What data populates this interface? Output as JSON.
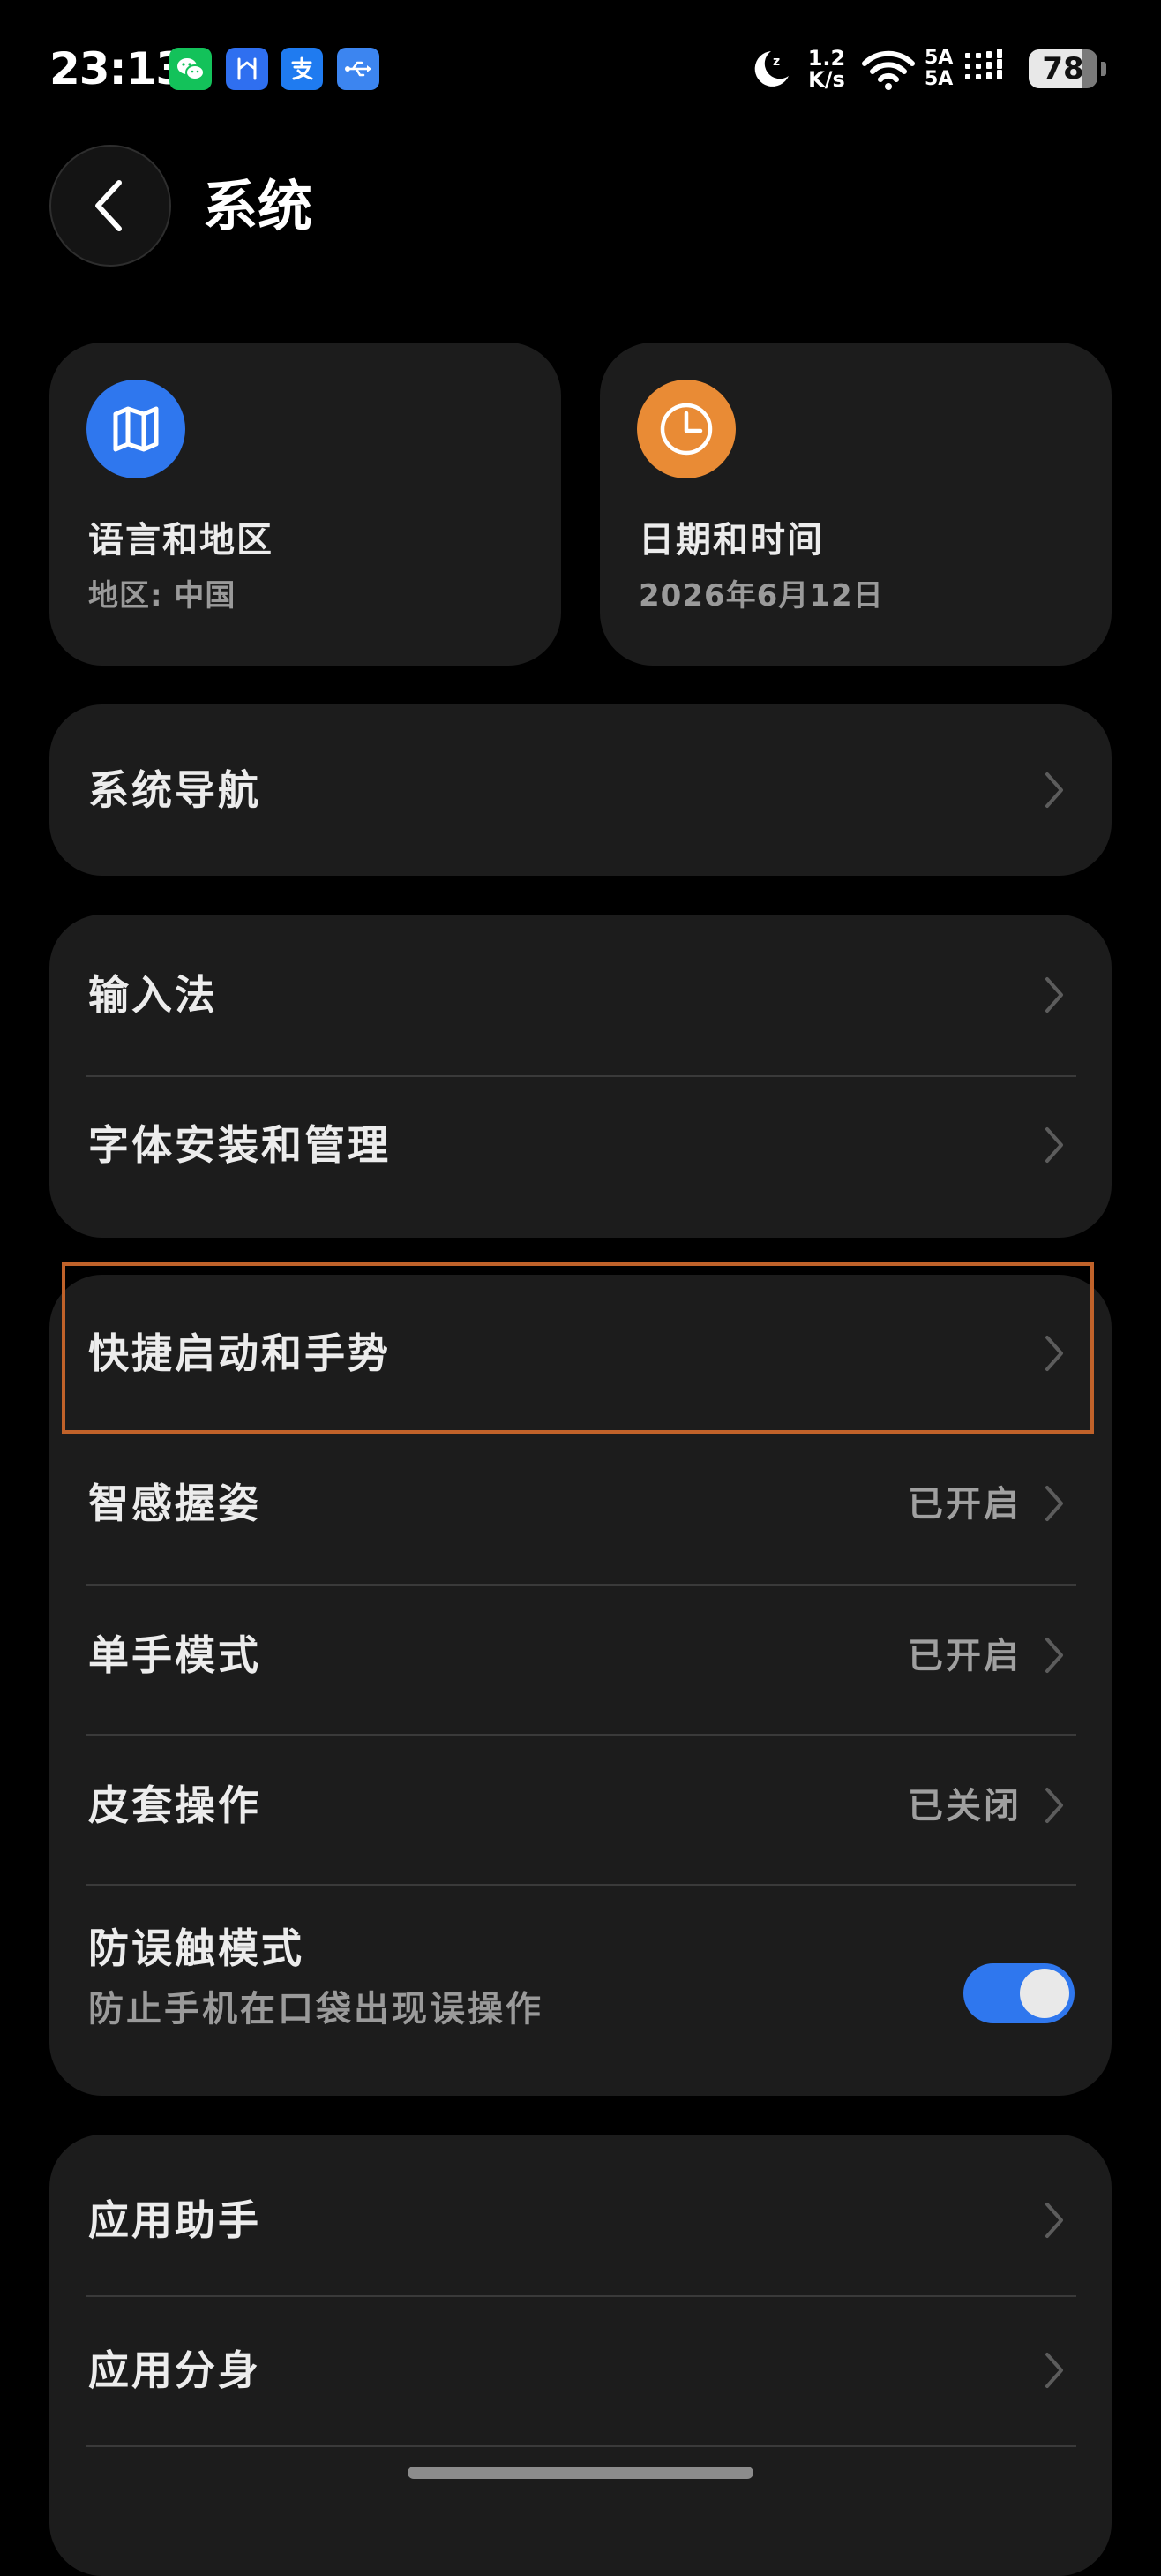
{
  "status_bar": {
    "time": "23:13",
    "net_speed_value": "1.2",
    "net_speed_unit": "K/s",
    "sim1_label": "5A",
    "sim2_label": "5A",
    "battery_level": "78",
    "battery_fraction": 0.78,
    "notification_icons": [
      "wechat-icon",
      "hm-app-icon",
      "alipay-icon",
      "usb-icon"
    ]
  },
  "header": {
    "title": "系统"
  },
  "tiles": [
    {
      "title": "语言和地区",
      "subtitle": "地区: 中国",
      "icon": "map-icon",
      "icon_color": "#2f77ee"
    },
    {
      "title": "日期和时间",
      "subtitle": "2026年6月12日",
      "icon": "clock-icon",
      "icon_color": "#e98b35"
    }
  ],
  "groups": {
    "nav": {
      "items": [
        {
          "label": "系统导航"
        }
      ]
    },
    "input": {
      "items": [
        {
          "label": "输入法"
        },
        {
          "label": "字体安装和管理"
        }
      ]
    },
    "gestures": {
      "items": [
        {
          "label": "快捷启动和手势"
        },
        {
          "label": "智感握姿",
          "value": "已开启"
        },
        {
          "label": "单手模式",
          "value": "已开启"
        },
        {
          "label": "皮套操作",
          "value": "已关闭"
        },
        {
          "label": "防误触模式",
          "subtitle": "防止手机在口袋出现误操作",
          "toggle_on": true
        }
      ]
    },
    "apps": {
      "items": [
        {
          "label": "应用助手"
        },
        {
          "label": "应用分身"
        }
      ]
    }
  },
  "colors": {
    "background": "#000000",
    "card": "#1c1c1c",
    "accent": "#2f77ee",
    "highlight": "#c0622a"
  }
}
